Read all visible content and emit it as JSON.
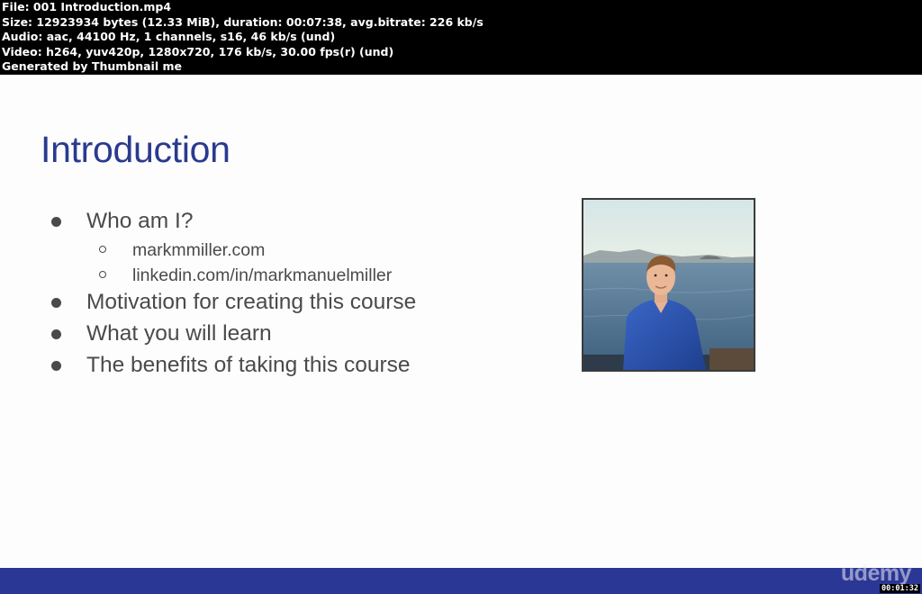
{
  "file_info": {
    "lines": [
      "File: 001 Introduction.mp4",
      "Size: 12923934 bytes (12.33 MiB), duration: 00:07:38, avg.bitrate: 226 kb/s",
      "Audio: aac, 44100 Hz, 1 channels, s16, 46 kb/s (und)",
      "Video: h264, yuv420p, 1280x720, 176 kb/s, 30.00 fps(r) (und)",
      "Generated by Thumbnail me"
    ]
  },
  "slide": {
    "title": "Introduction",
    "bullets": [
      {
        "text": "Who am I?",
        "level": 1
      },
      {
        "text": "markmmiller.com",
        "level": 2
      },
      {
        "text": "linkedin.com/in/markmanuelmiller",
        "level": 2
      },
      {
        "text": "Motivation for creating this course",
        "level": 1
      },
      {
        "text": "What you will learn",
        "level": 1
      },
      {
        "text": "The benefits of taking this course",
        "level": 1
      }
    ]
  },
  "footer": {
    "logo_text": "udemy",
    "timestamp": "00:01:32"
  },
  "colors": {
    "title": "#2a3a8f",
    "footer_bar": "#2b3794",
    "body_text": "#4a4a4a"
  }
}
